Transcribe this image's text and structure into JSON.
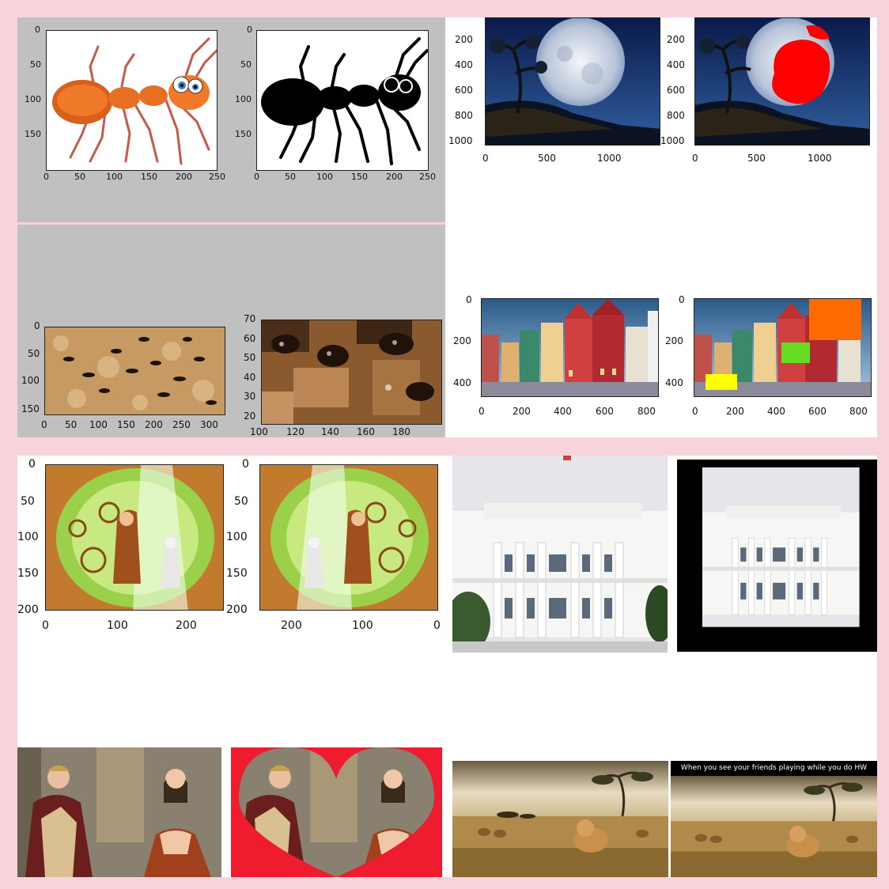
{
  "ant_plots": {
    "y_ticks": [
      "0",
      "50",
      "100",
      "150"
    ],
    "x_ticks": [
      "0",
      "50",
      "100",
      "150",
      "200",
      "250"
    ]
  },
  "ants_photo": {
    "y_ticks": [
      "0",
      "50",
      "100",
      "150"
    ],
    "x_ticks": [
      "0",
      "50",
      "100",
      "150",
      "200",
      "250",
      "300"
    ]
  },
  "ants_zoom": {
    "y_ticks": [
      "70",
      "60",
      "50",
      "40",
      "30",
      "20"
    ],
    "x_ticks": [
      "100",
      "120",
      "140",
      "160",
      "180"
    ]
  },
  "moon_plots": {
    "y_ticks": [
      "200",
      "400",
      "600",
      "800",
      "1000"
    ],
    "x_ticks": [
      "0",
      "500",
      "1000"
    ]
  },
  "town_plots": {
    "y_ticks": [
      "0",
      "200",
      "400"
    ],
    "x_ticks": [
      "0",
      "200",
      "400",
      "600",
      "800"
    ]
  },
  "forest_plots": {
    "y_ticks_left": [
      "0",
      "50",
      "100",
      "150",
      "200"
    ],
    "y_ticks_right": [
      "0",
      "50",
      "100",
      "150",
      "200"
    ],
    "x_ticks_left": [
      "0",
      "100",
      "200"
    ],
    "x_ticks_right": [
      "200",
      "100",
      "0"
    ]
  },
  "meme": {
    "caption": "When you see your friends playing while you do HW"
  },
  "colors": {
    "background": "#f7d4dc",
    "panel_gray": "#c0c0c0",
    "red_mask": "#ff0000",
    "orange_box": "#ff6a00",
    "green_box": "#66dd22",
    "yellow_box": "#ffff00"
  }
}
